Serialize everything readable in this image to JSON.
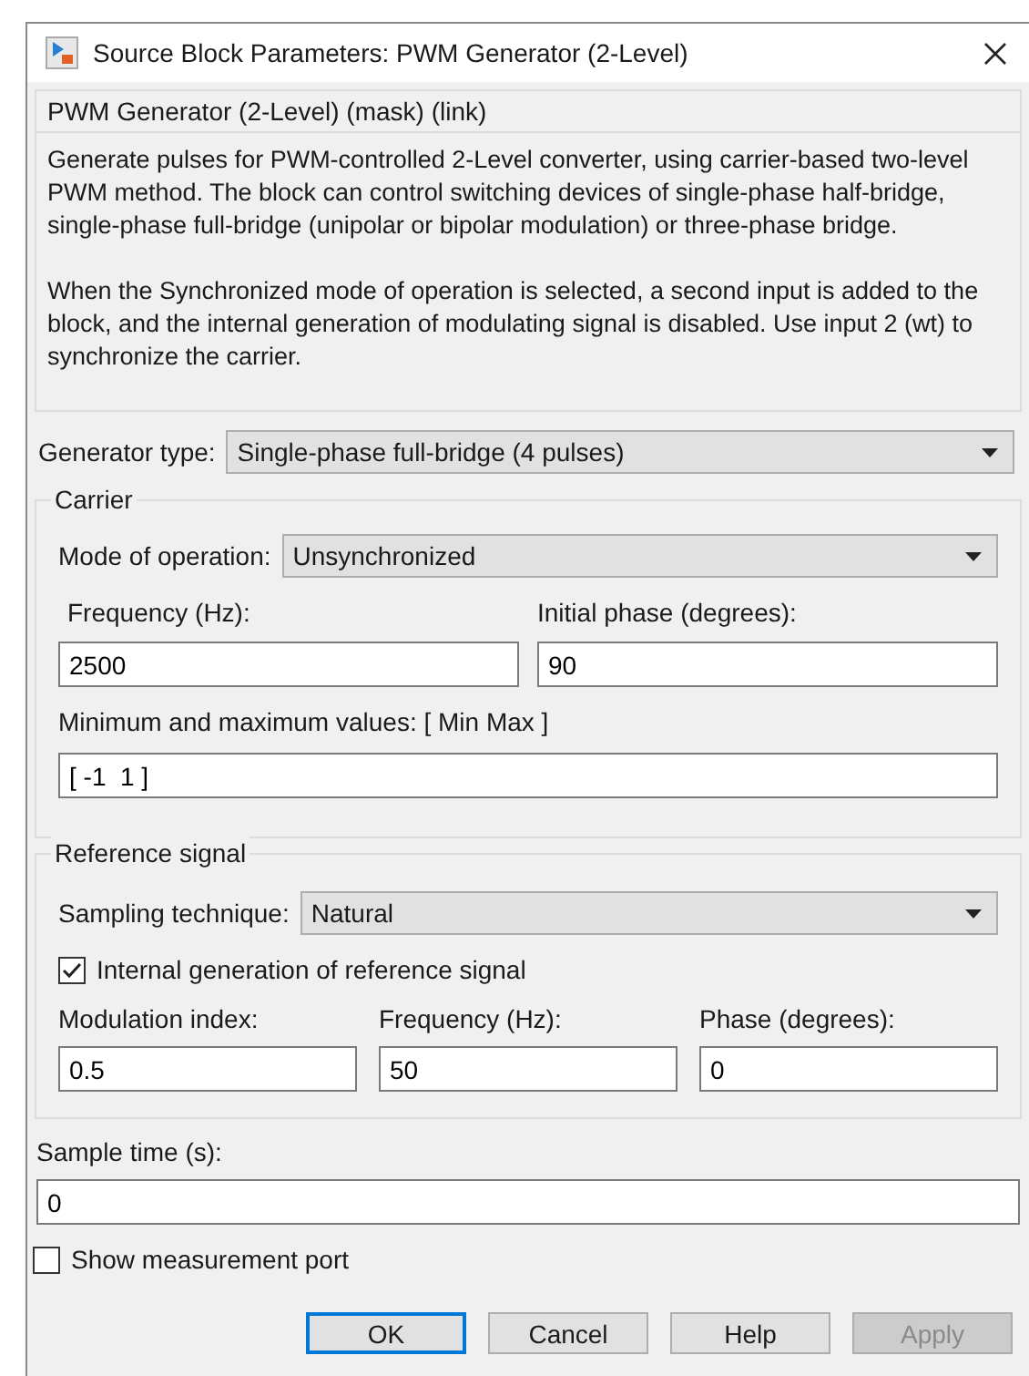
{
  "window": {
    "title": "Source Block Parameters: PWM Generator (2-Level)"
  },
  "mask_title": "PWM Generator (2-Level) (mask) (link)",
  "description": [
    "Generate pulses for PWM-controlled 2-Level converter, using carrier-based two-level PWM method. The block can control switching devices of single-phase half-bridge, single-phase full-bridge (unipolar or bipolar modulation) or three-phase bridge.",
    "When the Synchronized mode of operation is selected, a second input is added to the block, and the internal generation of modulating signal is disabled. Use input 2 (wt) to synchronize the carrier."
  ],
  "generator_type": {
    "label": "Generator type:",
    "value": "Single-phase full-bridge (4 pulses)"
  },
  "carrier": {
    "title": "Carrier",
    "mode": {
      "label": "Mode of operation:",
      "value": "Unsynchronized"
    },
    "frequency": {
      "label": "Frequency (Hz):",
      "value": "2500"
    },
    "initial_phase": {
      "label": "Initial phase (degrees):",
      "value": "90"
    },
    "min_max": {
      "label": "Minimum and maximum values: [ Min  Max ]",
      "value": "[ -1  1 ]"
    }
  },
  "reference_signal": {
    "title": "Reference signal",
    "sampling": {
      "label": "Sampling technique:",
      "value": "Natural"
    },
    "internal_generation": {
      "label": "Internal generation of reference signal",
      "checked": true
    },
    "fields": [
      {
        "label": "Modulation index:",
        "value": "0.5"
      },
      {
        "label": "Frequency (Hz):",
        "value": "50"
      },
      {
        "label": "Phase (degrees):",
        "value": "0"
      }
    ]
  },
  "sample_time": {
    "label": "Sample time (s):",
    "value": "0"
  },
  "show_measurement_port": {
    "label": "Show measurement port",
    "checked": false
  },
  "buttons": [
    {
      "label": "OK",
      "focused": true,
      "disabled": false
    },
    {
      "label": "Cancel",
      "focused": false,
      "disabled": false
    },
    {
      "label": "Help",
      "focused": false,
      "disabled": false
    },
    {
      "label": "Apply",
      "focused": false,
      "disabled": true
    }
  ]
}
